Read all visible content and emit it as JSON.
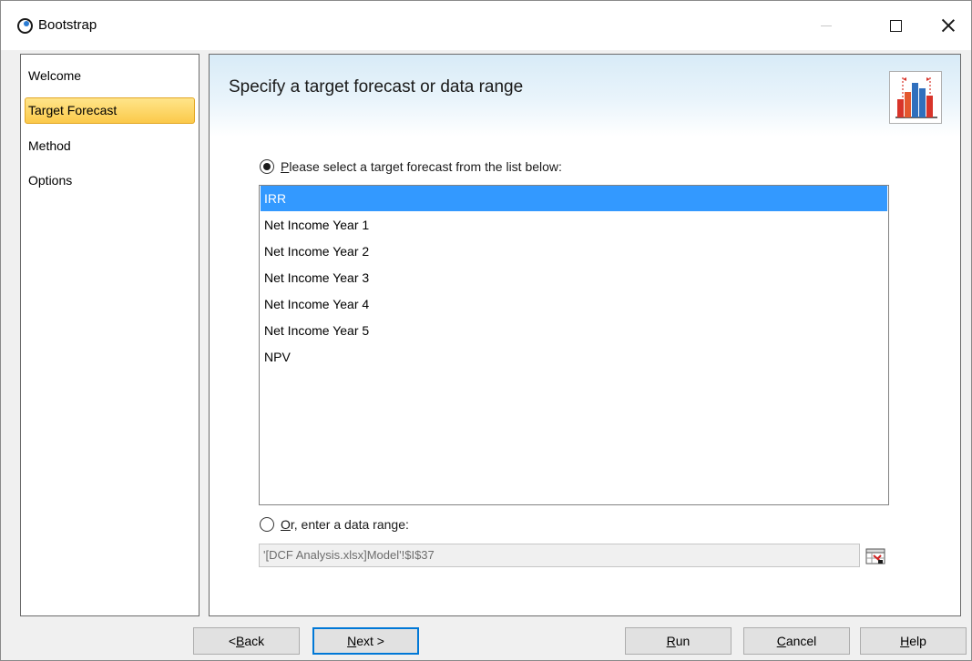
{
  "window": {
    "title": "Bootstrap"
  },
  "sidebar": {
    "items": [
      {
        "label": "Welcome",
        "active": false
      },
      {
        "label": "Target Forecast",
        "active": true
      },
      {
        "label": "Method",
        "active": false
      },
      {
        "label": "Options",
        "active": false
      }
    ]
  },
  "main": {
    "heading": "Specify a target forecast or data range",
    "option_forecast": {
      "underlined": "P",
      "rest": "lease select a target forecast from the list below:",
      "checked": true
    },
    "forecasts": [
      "IRR",
      "Net Income Year 1",
      "Net Income Year 2",
      "Net Income Year 3",
      "Net Income Year 4",
      "Net Income Year 5",
      "NPV"
    ],
    "selected_forecast": "IRR",
    "option_range": {
      "underlined": "O",
      "rest": "r, enter a data range:",
      "checked": false
    },
    "range_value": "'[DCF Analysis.xlsx]Model'!$I$37"
  },
  "buttons": {
    "back": {
      "prefix": "< ",
      "underlined": "B",
      "rest": "ack"
    },
    "next": {
      "prefix": "",
      "underlined": "N",
      "rest": "ext >"
    },
    "run": {
      "prefix": "",
      "underlined": "R",
      "rest": "un"
    },
    "cancel": {
      "prefix": "",
      "underlined": "C",
      "rest": "ancel"
    },
    "help": {
      "prefix": "",
      "underlined": "H",
      "rest": "elp"
    }
  },
  "colors": {
    "selection": "#3399ff",
    "active_nav": "#fbc94a",
    "default_button_border": "#0078d7"
  }
}
